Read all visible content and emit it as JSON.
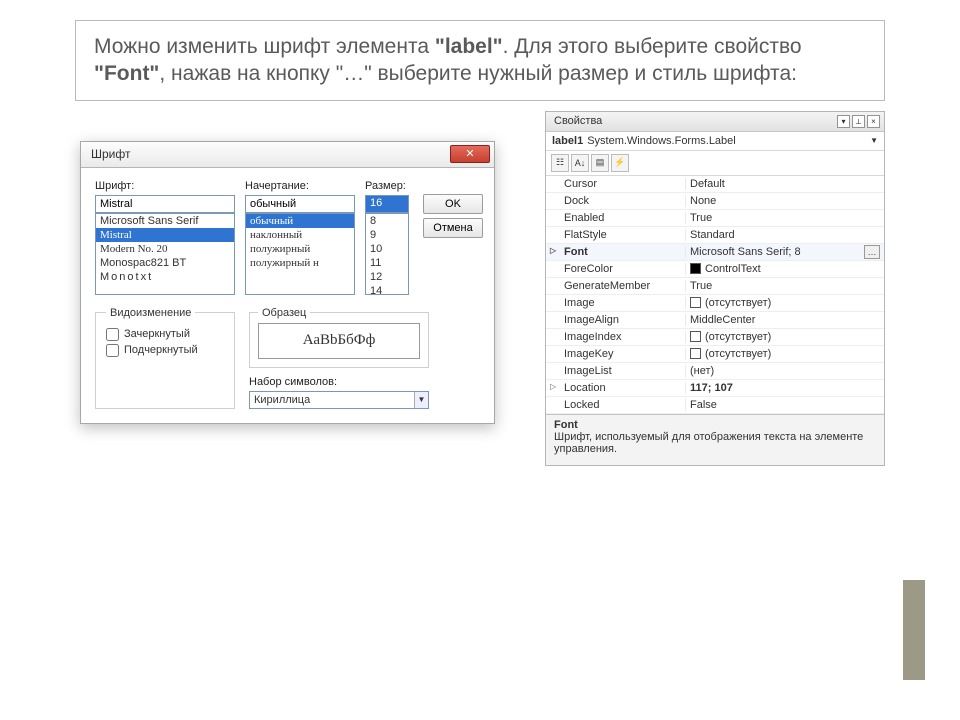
{
  "heading": {
    "p1": "Можно изменить шрифт элемента ",
    "b1": "\"label\"",
    "p2": ". Для этого выберите свойство ",
    "b2": "\"Font\"",
    "p3": ", нажав на кнопку \"…\" выберите нужный размер и стиль шрифта:"
  },
  "fontDialog": {
    "title": "Шрифт",
    "labels": {
      "font": "Шрифт:",
      "style": "Начертание:",
      "size": "Размер:"
    },
    "fontInput": "Mistral",
    "styleInput": "обычный",
    "sizeInput": "16",
    "fonts": [
      "Microsoft Sans Serif",
      "Mistral",
      "Modern No. 20",
      "Monospac821 BT",
      "Monotxt"
    ],
    "fontsSelIndex": 1,
    "styles": [
      "обычный",
      "наклонный",
      "полужирный",
      "полужирный н"
    ],
    "stylesSelIndex": 0,
    "sizes": [
      "8",
      "9",
      "10",
      "11",
      "12",
      "14",
      "16"
    ],
    "sizesSelIndex": 6,
    "ok": "OK",
    "cancel": "Отмена",
    "effects": {
      "legend": "Видоизменение",
      "strike": "Зачеркнутый",
      "under": "Подчеркнутый"
    },
    "sample": {
      "legend": "Образец",
      "text": "АаBbБбФф"
    },
    "charset": {
      "label": "Набор символов:",
      "value": "Кириллица"
    }
  },
  "props": {
    "title": "Свойства",
    "object": {
      "name": "label1",
      "type": "System.Windows.Forms.Label"
    },
    "rows": [
      {
        "k": "Cursor",
        "v": "Default"
      },
      {
        "k": "Dock",
        "v": "None"
      },
      {
        "k": "Enabled",
        "v": "True"
      },
      {
        "k": "FlatStyle",
        "v": "Standard"
      },
      {
        "k": "Font",
        "v": "Microsoft Sans Serif; 8",
        "exp": true,
        "focus": true,
        "ell": true
      },
      {
        "k": "ForeColor",
        "v": "ControlText",
        "swatch": true
      },
      {
        "k": "GenerateMember",
        "v": "True"
      },
      {
        "k": "Image",
        "v": "(отсутствует)",
        "empty": true
      },
      {
        "k": "ImageAlign",
        "v": "MiddleCenter"
      },
      {
        "k": "ImageIndex",
        "v": "(отсутствует)",
        "empty": true
      },
      {
        "k": "ImageKey",
        "v": "(отсутствует)",
        "empty": true
      },
      {
        "k": "ImageList",
        "v": "(нет)"
      },
      {
        "k": "Location",
        "v": "117; 107",
        "bold": true,
        "exp": true
      },
      {
        "k": "Locked",
        "v": "False"
      }
    ],
    "desc": {
      "title": "Font",
      "text": "Шрифт, используемый для отображения текста на элементе управления."
    }
  }
}
